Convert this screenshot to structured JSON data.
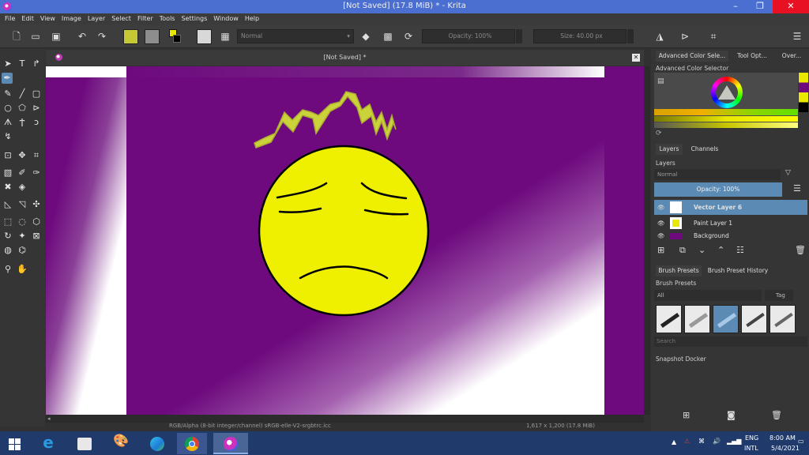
{
  "window": {
    "title": "[Not Saved]  (17.8 MiB)  * - Krita",
    "minimize": "–",
    "maximize": "❐",
    "close": "✕"
  },
  "menu": [
    "File",
    "Edit",
    "View",
    "Image",
    "Layer",
    "Select",
    "Filter",
    "Tools",
    "Settings",
    "Window",
    "Help"
  ],
  "toolbar": {
    "blend_mode": "Normal",
    "opacity": "Opacity: 100%",
    "size": "Size: 40.00 px"
  },
  "canvas": {
    "tab_title": "[Not Saved]  *",
    "status": "RGB/Alpha (8-bit integer/channel)  sRGB-elle-V2-srgbtrc.icc",
    "status_right": "1,617 x 1,200 (17.8 MiB)"
  },
  "docker": {
    "tabs": [
      "Advanced Color Sele...",
      "Tool Opt...",
      "Over..."
    ],
    "color_selector_label": "Advanced Color Selector",
    "layers_tabs": [
      "Layers",
      "Channels"
    ],
    "layers_label": "Layers",
    "layer_blend": "Normal",
    "layer_opacity": "Opacity:  100%",
    "layers": [
      {
        "name": "Vector Layer 6",
        "selected": true
      },
      {
        "name": "Paint Layer 1",
        "selected": false
      },
      {
        "name": "Background",
        "selected": false
      }
    ],
    "brush_tabs": [
      "Brush Presets",
      "Brush Preset History"
    ],
    "brush_label": "Brush Presets",
    "brush_filter": "All",
    "tag_label": "Tag",
    "search_placeholder": "Search",
    "snapshot_label": "Snapshot Docker"
  },
  "taskbar": {
    "lang_top": "ENG",
    "lang_bottom": "INTL",
    "time": "8:00 AM",
    "date": "5/4/2021"
  },
  "colors": {
    "purple": "#6e0a7e",
    "face_yellow": "#eef000",
    "hair_yellow": "#cbd23a",
    "accent": "#5b8bb4"
  }
}
